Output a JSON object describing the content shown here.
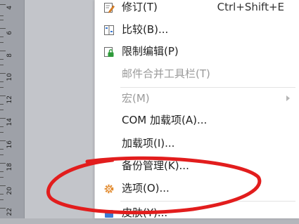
{
  "ruler": {
    "labels": [
      "4",
      "6",
      "8",
      "10",
      "12",
      "14",
      "16",
      "18",
      "20",
      "22"
    ]
  },
  "menu": {
    "items": [
      {
        "label": "修订(T)",
        "shortcut": "Ctrl+Shift+E",
        "icon": "track-changes-icon"
      },
      {
        "label": "比较(B)...",
        "icon": "compare-icon"
      },
      {
        "label": "限制编辑(P)",
        "icon": "lock-edit-icon"
      },
      {
        "label": "邮件合并工具栏(T)"
      },
      {
        "label": "宏(M)"
      },
      {
        "label": "COM 加载项(A)..."
      },
      {
        "label": "加载项(I)..."
      },
      {
        "label": "备份管理(K)..."
      },
      {
        "label": "选项(O)...",
        "icon": "gear-icon"
      },
      {
        "label": "皮肤(Y)..."
      }
    ]
  },
  "colors": {
    "highlight_ring": "#e21d1d",
    "icon_blue": "#3a7bd5",
    "icon_green": "#2e9a3a",
    "icon_orange": "#e2892b"
  }
}
